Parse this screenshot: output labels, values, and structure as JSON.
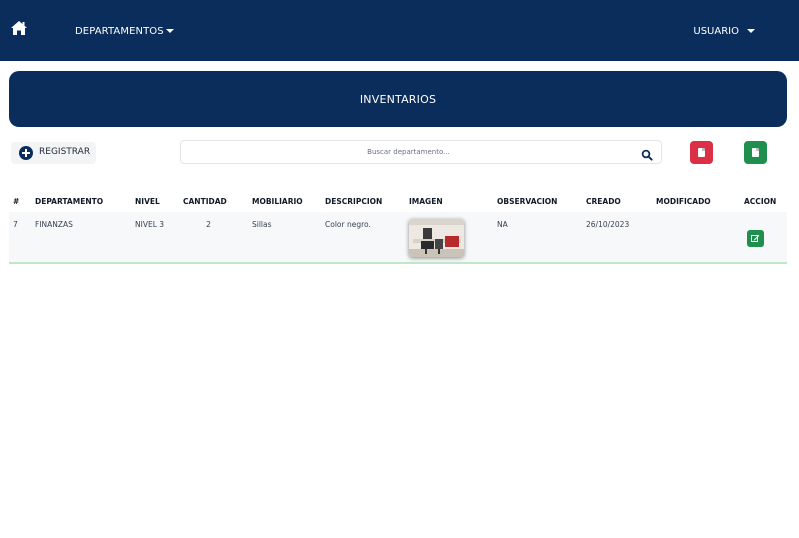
{
  "nav": {
    "home_icon": "home-icon",
    "departments_label": "DEPARTAMENTOS",
    "user_label": "USUARIO"
  },
  "banner": {
    "title": "INVENTARIOS"
  },
  "toolbar": {
    "register_label": "REGISTRAR",
    "register_icon": "plus-circle-icon",
    "search_placeholder": "Buscar departamento...",
    "search_icon": "search-icon",
    "pdf_icon": "file-pdf-icon",
    "excel_icon": "file-excel-icon"
  },
  "table": {
    "headers": [
      "#",
      "DEPARTAMENTO",
      "NIVEL",
      "CANTIDAD",
      "MOBILIARIO",
      "DESCRIPCION",
      "IMAGEN",
      "OBSERVACION",
      "CREADO",
      "MODIFICADO",
      "ACCION"
    ],
    "rows": [
      {
        "id": "7",
        "departamento": "FINANZAS",
        "nivel": "NIVEL 3",
        "cantidad": "2",
        "mobiliario": "Sillas",
        "descripcion": "Color negro.",
        "imagen": "office-chairs-photo",
        "observacion": "NA",
        "creado": "26/10/2023",
        "modificado": "",
        "accion_icon": "edit-icon"
      }
    ]
  },
  "colors": {
    "navy": "#0b2d5b",
    "danger": "#dc2f45",
    "success": "#1f8f4e",
    "row_bg": "#f6f8fa",
    "row_border": "#bfe8c5"
  }
}
